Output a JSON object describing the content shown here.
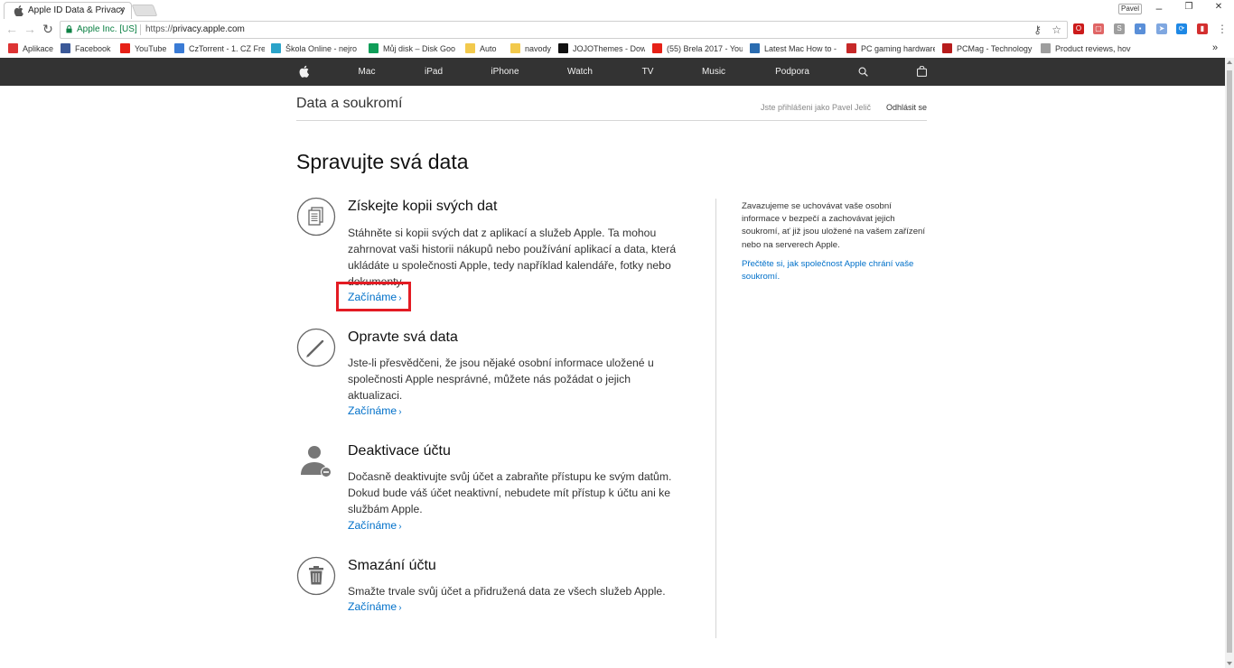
{
  "browser": {
    "tab_title": "Apple ID Data & Privacy",
    "tab_close": "×",
    "profile_name": "Pavel",
    "window_controls": {
      "minimize": "–",
      "restore": "❐",
      "close": "✕"
    },
    "nav": {
      "back": "←",
      "forward": "→",
      "reload": "↻"
    },
    "site_identity": "Apple Inc. [US]",
    "url_scheme": "https://",
    "url_host": "privacy.apple.com",
    "omnibox_icons": {
      "key": "⚷",
      "star": "☆"
    },
    "extensions": [
      {
        "name": "opera-icon",
        "color": "#cc1b1b",
        "glyph": "O"
      },
      {
        "name": "pdf-icon",
        "color": "#e06666",
        "glyph": "▢"
      },
      {
        "name": "ext-s-icon",
        "color": "#9e9e9e",
        "glyph": "S"
      },
      {
        "name": "ext-blue-icon",
        "color": "#5a8fd8",
        "glyph": "▪"
      },
      {
        "name": "ext-arrow-icon",
        "color": "#7fa7e0",
        "glyph": "➤"
      },
      {
        "name": "ext-circle-icon",
        "color": "#1e88e5",
        "glyph": "⟳"
      },
      {
        "name": "ext-red-icon",
        "color": "#d32f2f",
        "glyph": "▮"
      },
      {
        "name": "menu-icon",
        "color": "#666666",
        "glyph": "⋮"
      }
    ],
    "bookmarks": [
      {
        "label": "Aplikace",
        "icon": "apps-icon",
        "color": "#d33"
      },
      {
        "label": "Facebook",
        "icon": "facebook-icon",
        "color": "#3b5998"
      },
      {
        "label": "YouTube",
        "icon": "youtube-icon",
        "color": "#e62117"
      },
      {
        "label": "CzTorrent - 1. CZ Fre",
        "icon": "cztorrent-icon",
        "color": "#3a7bd5"
      },
      {
        "label": "Škola Online - nejro",
        "icon": "skola-icon",
        "color": "#2aa3c9"
      },
      {
        "label": "Můj disk – Disk Goo",
        "icon": "drive-icon",
        "color": "#0f9d58"
      },
      {
        "label": "Auto",
        "icon": "folder-icon",
        "color": "#f2c94c"
      },
      {
        "label": "navody",
        "icon": "folder-icon",
        "color": "#f2c94c"
      },
      {
        "label": "JOJOThemes - Down",
        "icon": "jojo-icon",
        "color": "#111111"
      },
      {
        "label": "(55) Brela 2017 - You",
        "icon": "youtube-icon",
        "color": "#e62117"
      },
      {
        "label": "Latest Mac How to -",
        "icon": "m-icon",
        "color": "#2b6cb0"
      },
      {
        "label": "PC gaming hardware",
        "icon": "pcgamer-icon",
        "color": "#c62828"
      },
      {
        "label": "PCMag - Technology",
        "icon": "pcmag-icon",
        "color": "#b71c1c"
      },
      {
        "label": "Product reviews, hov",
        "icon": "page-icon",
        "color": "#9e9e9e"
      }
    ],
    "bookmarks_overflow": "»"
  },
  "globalnav": {
    "apple_logo": "",
    "items": [
      "Mac",
      "iPad",
      "iPhone",
      "Watch",
      "TV",
      "Music",
      "Podpora"
    ],
    "search_icon": "search-icon",
    "bag_icon": "bag-icon"
  },
  "localnav": {
    "title": "Data a soukromí",
    "signed_in": "Jste přihlášeni jako Pavel Jelič",
    "logout": "Odhlásit se"
  },
  "page_title": "Spravujte svá data",
  "sections": [
    {
      "icon": "document-copy-icon",
      "heading": "Získejte kopii svých dat",
      "body": "Stáhněte si kopii svých dat z aplikací a služeb Apple. Ta mohou zahrnovat vaši historii nákupů nebo používání aplikací a data, která ukládáte u společnosti Apple, tedy například kalendáře, fotky nebo dokumenty.",
      "link": "Začínáme",
      "chevron": "›"
    },
    {
      "icon": "pencil-icon",
      "heading": "Opravte svá data",
      "body": "Jste-li přesvědčeni, že jsou nějaké osobní informace uložené u společnosti Apple nesprávné, můžete nás požádat o jejich aktualizaci.",
      "link": "Začínáme",
      "chevron": "›"
    },
    {
      "icon": "user-deactivate-icon",
      "heading": "Deaktivace účtu",
      "body": "Dočasně deaktivujte svůj účet a zabraňte přístupu ke svým datům. Dokud bude váš účet neaktivní, nebudete mít přístup k účtu ani ke službám Apple.",
      "link": "Začínáme",
      "chevron": "›"
    },
    {
      "icon": "trash-icon",
      "heading": "Smazání účtu",
      "body": "Smažte trvale svůj účet a přidružená data ze všech služeb Apple.",
      "link": "Začínáme",
      "chevron": "›"
    }
  ],
  "aside": {
    "text": "Zavazujeme se uchovávat vaše osobní informace v bezpečí a zachovávat jejich soukromí, ať již jsou uložené na vašem zařízení nebo na serverech Apple.",
    "link": "Přečtěte si, jak společnost Apple chrání vaše soukromí."
  },
  "colors": {
    "link": "#0070c9",
    "globalnav_bg": "#333333",
    "highlight": "#e31b23"
  }
}
